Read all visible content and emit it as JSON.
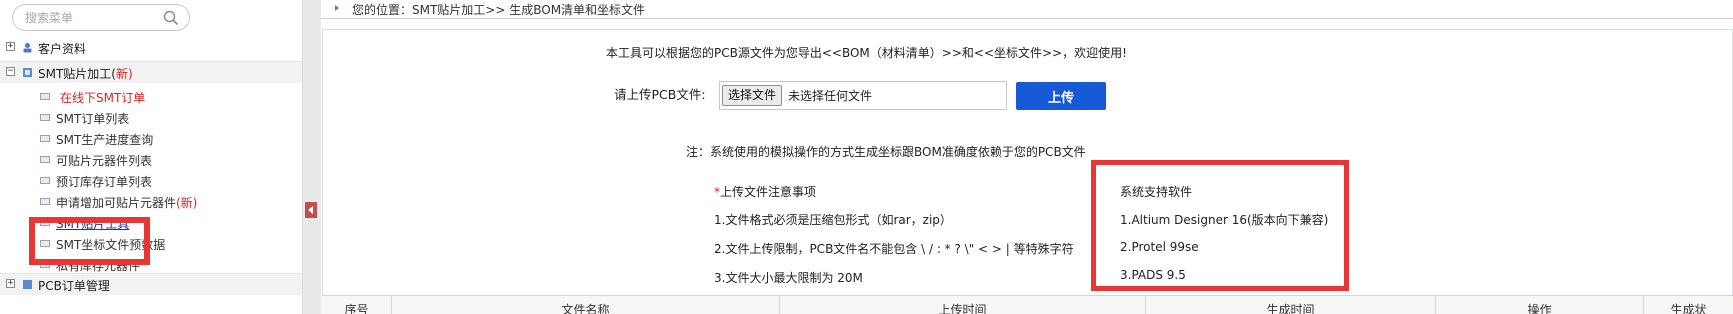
{
  "sidebar": {
    "search": {
      "placeholder": "搜索菜单"
    },
    "groups": [
      {
        "label": "客户资料",
        "expander": "+"
      },
      {
        "label": "SMT贴片加工(",
        "badge": "新)",
        "expander": "−"
      },
      {
        "label": "PCB订单管理",
        "expander": "+"
      }
    ],
    "items": [
      {
        "label": "在线下SMT订单"
      },
      {
        "label": "SMT订单列表"
      },
      {
        "label": "SMT生产进度查询"
      },
      {
        "label": "可贴片元器件列表"
      },
      {
        "label": "预订库存订单列表"
      },
      {
        "label": "申请增加可贴片元器件",
        "badge": "(新)"
      },
      {
        "label": "SMT贴片工具"
      },
      {
        "label": "SMT坐标文件预数据"
      },
      {
        "label": "私有库存元器件"
      }
    ]
  },
  "breadcrumb": {
    "text": "您的位置：SMT贴片加工>> 生成BOM清单和坐标文件"
  },
  "main": {
    "intro": "本工具可以根据您的PCB源文件为您导出<<BOM（材料清单）>>和<<坐标文件>>，欢迎使用!",
    "upload_label": "请上传PCB文件:",
    "choose_button": "选择文件",
    "no_file": "未选择任何文件",
    "upload_button": "上传",
    "note": "注：系统使用的模拟操作的方式生成坐标跟BOM准确度依赖于您的PCB文件",
    "notice": {
      "star": "*",
      "title": "上传文件注意事项",
      "items": [
        "1.文件格式必须是压缩包形式（如rar，zip）",
        "2.文件上传限制，PCB文件名不能包含 \\ / : * ? \\\" < > | 等特殊字符",
        "3.文件大小最大限制为 20M"
      ]
    },
    "software": {
      "title": "系统支持软件",
      "items": [
        "1.Altium Designer 16(版本向下兼容)",
        "2.Protel 99se",
        "3.PADS 9.5"
      ]
    }
  },
  "table": {
    "headers": [
      "序号",
      "文件名称",
      "上传时间",
      "生成时间",
      "操作",
      "生成状"
    ]
  },
  "colors": {
    "accent": "#1659d6",
    "highlight": "#e83535",
    "new_tag": "#e02020"
  }
}
